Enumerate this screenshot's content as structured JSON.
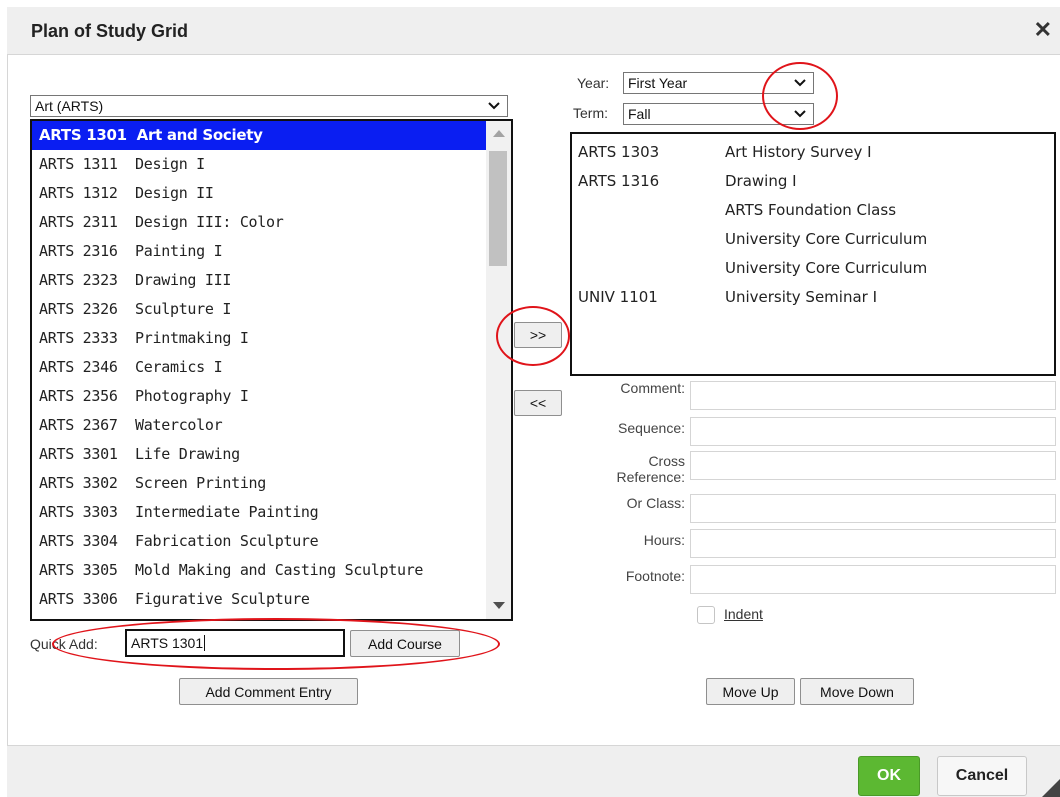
{
  "dialog": {
    "title": "Plan of Study Grid",
    "close_glyph": "✕"
  },
  "department_select": {
    "value": "Art (ARTS)"
  },
  "courses": [
    {
      "code": "ARTS 1301",
      "title": "Art and Society",
      "selected": true
    },
    {
      "code": "ARTS 1311",
      "title": "Design I"
    },
    {
      "code": "ARTS 1312",
      "title": "Design II"
    },
    {
      "code": "ARTS 2311",
      "title": "Design III: Color"
    },
    {
      "code": "ARTS 2316",
      "title": "Painting I"
    },
    {
      "code": "ARTS 2323",
      "title": "Drawing III"
    },
    {
      "code": "ARTS 2326",
      "title": "Sculpture I"
    },
    {
      "code": "ARTS 2333",
      "title": "Printmaking I"
    },
    {
      "code": "ARTS 2346",
      "title": "Ceramics I"
    },
    {
      "code": "ARTS 2356",
      "title": "Photography I"
    },
    {
      "code": "ARTS 2367",
      "title": "Watercolor"
    },
    {
      "code": "ARTS 3301",
      "title": "Life Drawing"
    },
    {
      "code": "ARTS 3302",
      "title": "Screen Printing"
    },
    {
      "code": "ARTS 3303",
      "title": "Intermediate Painting"
    },
    {
      "code": "ARTS 3304",
      "title": "Fabrication Sculpture"
    },
    {
      "code": "ARTS 3305",
      "title": "Mold Making and Casting Sculpture"
    },
    {
      "code": "ARTS 3306",
      "title": "Figurative Sculpture"
    }
  ],
  "quick_add": {
    "label": "Quick Add:",
    "value": "ARTS 1301",
    "button": "Add Course"
  },
  "add_comment_button": "Add Comment Entry",
  "move_buttons": {
    "add": ">>",
    "remove": "<<"
  },
  "year": {
    "label": "Year:",
    "value": "First Year"
  },
  "term": {
    "label": "Term:",
    "value": "Fall"
  },
  "term_courses": [
    {
      "code": "ARTS 1303",
      "title": "Art History Survey I"
    },
    {
      "code": "ARTS 1316",
      "title": "Drawing I"
    },
    {
      "code": "",
      "title": "ARTS Foundation Class"
    },
    {
      "code": "",
      "title": "University Core Curriculum"
    },
    {
      "code": "",
      "title": "University Core Curriculum"
    },
    {
      "code": "UNIV 1101",
      "title": "University Seminar I"
    }
  ],
  "fields": {
    "comment": "Comment:",
    "sequence": "Sequence:",
    "cross_reference_line1": "Cross",
    "cross_reference_line2": "Reference:",
    "or_class": "Or Class:",
    "hours": "Hours:",
    "footnote": "Footnote:"
  },
  "indent_label": "Indent",
  "order_buttons": {
    "up": "Move Up",
    "down": "Move Down"
  },
  "footer": {
    "ok": "OK",
    "cancel": "Cancel"
  },
  "colors": {
    "selected_bg": "#0a1ef2",
    "ok_green": "#5cb832",
    "annotation_red": "#e0141a"
  }
}
